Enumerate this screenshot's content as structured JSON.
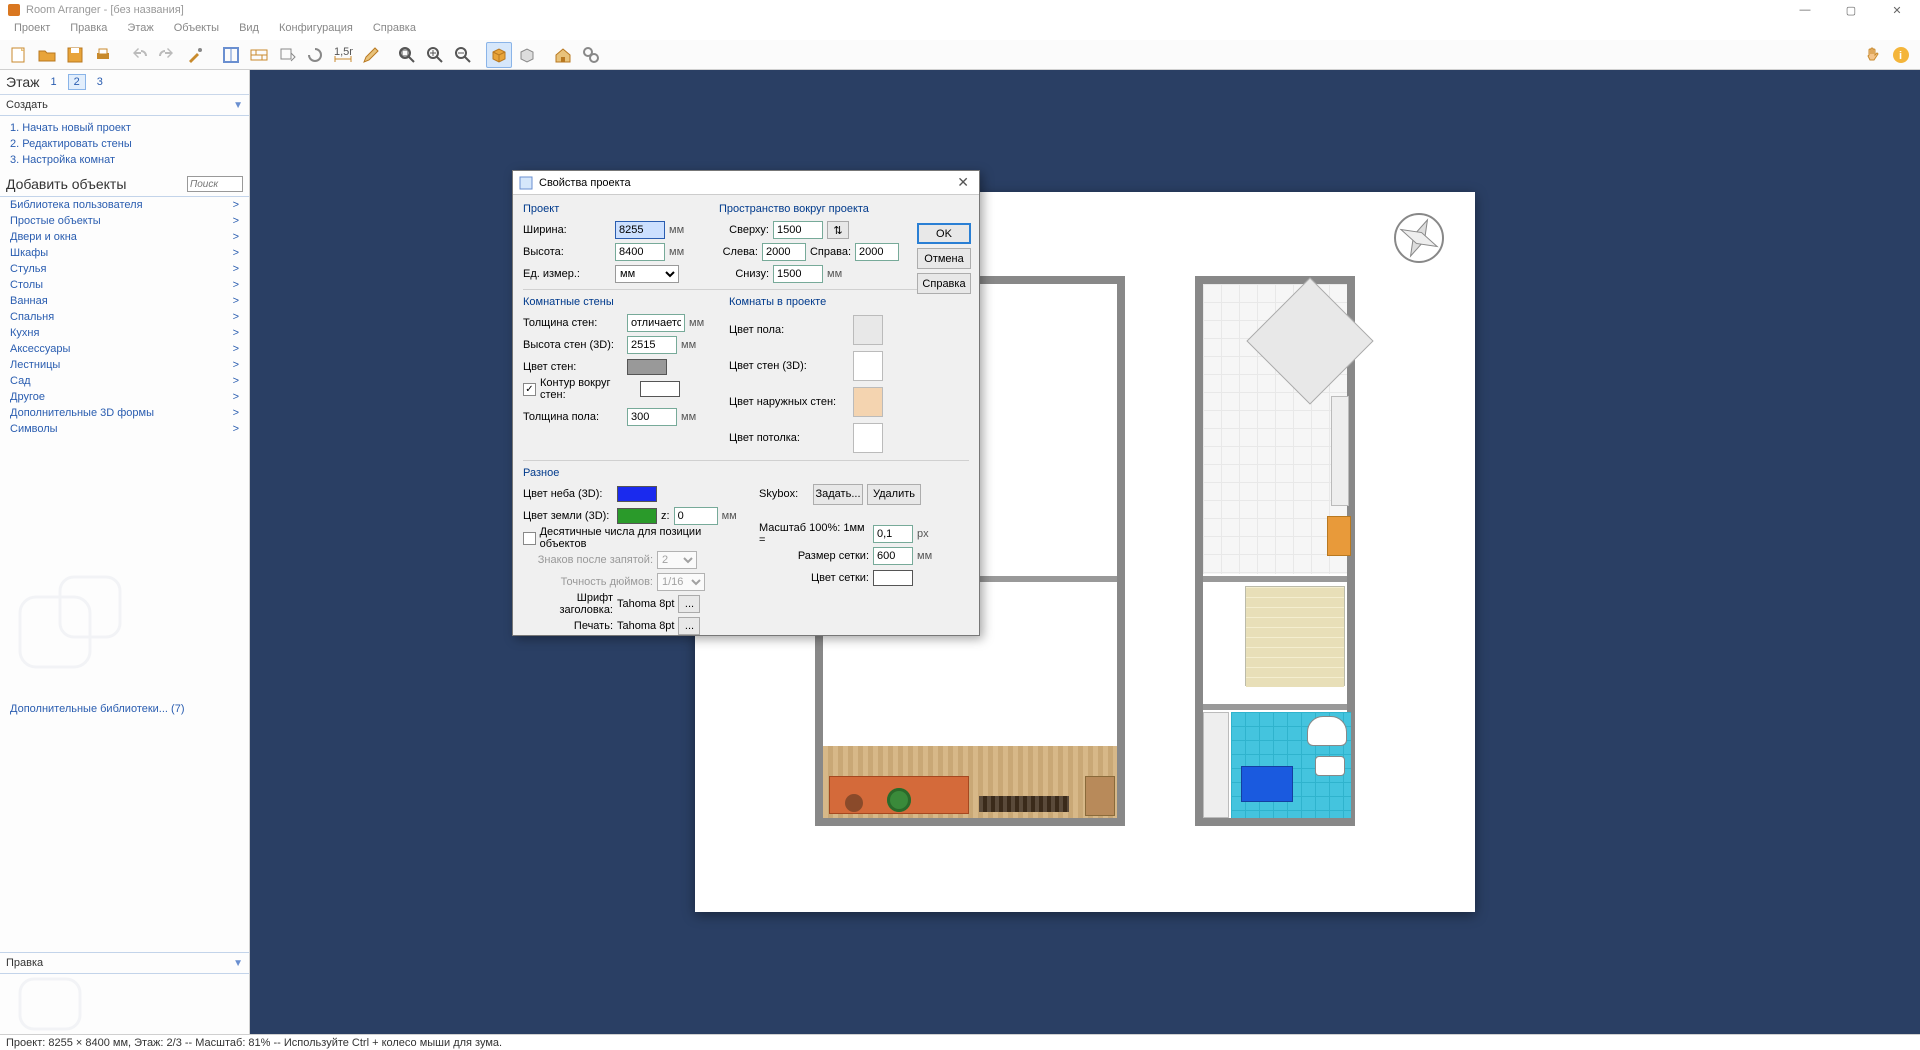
{
  "titlebar": {
    "app": "Room Arranger",
    "doc": "[без названия]"
  },
  "menubar": [
    "Проект",
    "Правка",
    "Этаж",
    "Объекты",
    "Вид",
    "Конфигурация",
    "Справка"
  ],
  "floors": {
    "label": "Этаж",
    "numbers": [
      "1",
      "2",
      "3"
    ],
    "current": 1
  },
  "sections": {
    "create": "Создать",
    "create_tasks": [
      "1. Начать новый проект",
      "2. Редактировать стены",
      "3. Настройка комнат"
    ],
    "add": "Добавить объекты",
    "search_ph": "Поиск",
    "categories": [
      "Библиотека пользователя",
      "Простые объекты",
      "Двери и окна",
      "Шкафы",
      "Стулья",
      "Столы",
      "Ванная",
      "Спальня",
      "Кухня",
      "Аксессуары",
      "Лестницы",
      "Сад",
      "Другое",
      "Дополнительные 3D формы",
      "Символы"
    ],
    "extra_libs": "Дополнительные библиотеки... (7)",
    "edit": "Правка"
  },
  "dialog": {
    "title": "Свойства проекта",
    "project": "Проект",
    "width_l": "Ширина:",
    "width_v": "8255",
    "mm": "мм",
    "height_l": "Высота:",
    "height_v": "8400",
    "units_l": "Ед. измер.:",
    "units_v": "мм",
    "space": "Пространство вокруг проекта",
    "top_l": "Сверху:",
    "top_v": "1500",
    "left_l": "Слева:",
    "left_v": "2000",
    "right_l": "Справа:",
    "right_v": "2000",
    "bottom_l": "Снизу:",
    "bottom_v": "1500",
    "walls": "Комнатные стены",
    "wall_th_l": "Толщина стен:",
    "wall_th_v": "отличается.",
    "wall_h_l": "Высота стен (3D):",
    "wall_h_v": "2515",
    "wall_c_l": "Цвет стен:",
    "outline_l": "Контур вокруг стен:",
    "floor_th_l": "Толщина пола:",
    "floor_th_v": "300",
    "rooms": "Комнаты в проекте",
    "floor_c_l": "Цвет пола:",
    "wall3d_c_l": "Цвет стен (3D):",
    "outer_c_l": "Цвет наружных стен:",
    "ceil_c_l": "Цвет потолка:",
    "misc": "Разное",
    "sky_l": "Цвет неба (3D):",
    "ground_l": "Цвет земли (3D):",
    "z_l": "z:",
    "z_v": "0",
    "decimal_l": "Десятичные числа для позиции объектов",
    "dec_after_l": "Знаков после запятой:",
    "dec_after_v": "2",
    "inch_prec_l": "Точность дюймов:",
    "inch_prec_v": "1/16",
    "header_font_l": "Шрифт заголовка:",
    "header_font_v": "Tahoma 8pt",
    "print_l": "Печать:",
    "print_v": "Tahoma 8pt",
    "skybox_l": "Skybox:",
    "set_btn": "Задать...",
    "del_btn": "Удалить",
    "scale_l": "Масштаб 100%: 1мм =",
    "scale_v": "0,1",
    "px": "px",
    "grid_l": "Размер сетки:",
    "grid_v": "600",
    "grid_c_l": "Цвет сетки:",
    "ok": "OK",
    "cancel": "Отмена",
    "help": "Справка",
    "ellipsis": "..."
  },
  "statusbar": "Проект: 8255 × 8400 мм, Этаж: 2/3 -- Масштаб: 81% -- Используйте Ctrl + колесо мыши для зума."
}
